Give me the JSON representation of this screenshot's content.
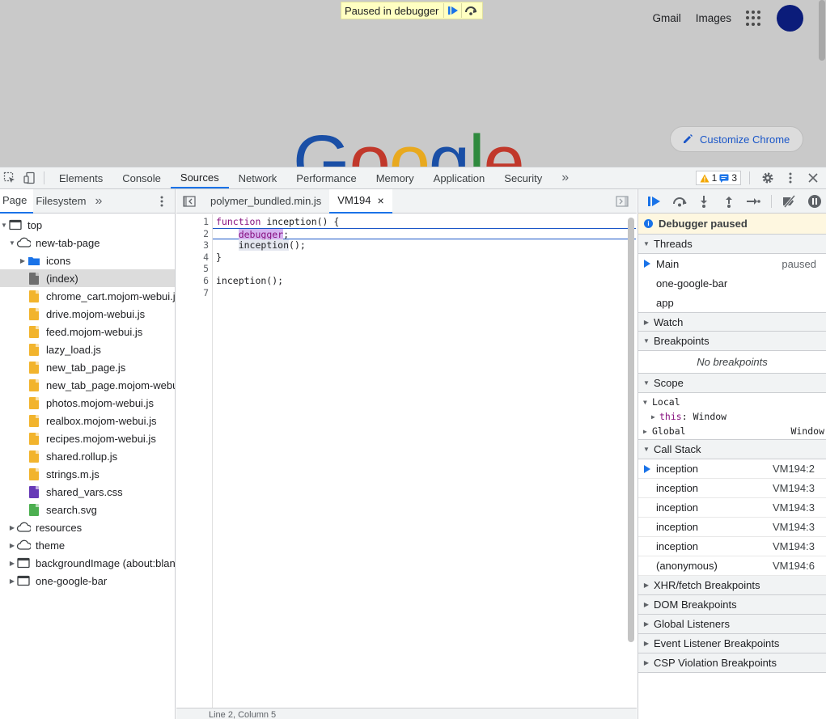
{
  "page": {
    "banner_text": "Paused in debugger",
    "links": [
      "Gmail",
      "Images"
    ],
    "logo": "Google",
    "customize_label": "Customize Chrome"
  },
  "toolbar": {
    "tabs": [
      "Elements",
      "Console",
      "Sources",
      "Network",
      "Performance",
      "Memory",
      "Application",
      "Security"
    ],
    "active_tab": "Sources",
    "more": "»",
    "warnings": "1",
    "messages": "3"
  },
  "navigator": {
    "tabs": [
      "Page",
      "Filesystem"
    ],
    "more": "»",
    "tree": [
      {
        "label": "top",
        "depth": 0,
        "type": "frame",
        "expanded": true
      },
      {
        "label": "new-tab-page",
        "depth": 1,
        "type": "cloud",
        "expanded": true
      },
      {
        "label": "icons",
        "depth": 2,
        "type": "folder",
        "expanded": false
      },
      {
        "label": "(index)",
        "depth": 2,
        "type": "file-grey",
        "selected": true
      },
      {
        "label": "chrome_cart.mojom-webui.js",
        "depth": 2,
        "type": "file-yellow"
      },
      {
        "label": "drive.mojom-webui.js",
        "depth": 2,
        "type": "file-yellow"
      },
      {
        "label": "feed.mojom-webui.js",
        "depth": 2,
        "type": "file-yellow"
      },
      {
        "label": "lazy_load.js",
        "depth": 2,
        "type": "file-yellow"
      },
      {
        "label": "new_tab_page.js",
        "depth": 2,
        "type": "file-yellow"
      },
      {
        "label": "new_tab_page.mojom-webui.js",
        "depth": 2,
        "type": "file-yellow"
      },
      {
        "label": "photos.mojom-webui.js",
        "depth": 2,
        "type": "file-yellow"
      },
      {
        "label": "realbox.mojom-webui.js",
        "depth": 2,
        "type": "file-yellow"
      },
      {
        "label": "recipes.mojom-webui.js",
        "depth": 2,
        "type": "file-yellow"
      },
      {
        "label": "shared.rollup.js",
        "depth": 2,
        "type": "file-yellow"
      },
      {
        "label": "strings.m.js",
        "depth": 2,
        "type": "file-yellow"
      },
      {
        "label": "shared_vars.css",
        "depth": 2,
        "type": "file-purple"
      },
      {
        "label": "search.svg",
        "depth": 2,
        "type": "file-green"
      },
      {
        "label": "resources",
        "depth": 1,
        "type": "cloud",
        "expanded": false
      },
      {
        "label": "theme",
        "depth": 1,
        "type": "cloud",
        "expanded": false
      },
      {
        "label": "backgroundImage (about:blank)",
        "depth": 1,
        "type": "frame",
        "expanded": false
      },
      {
        "label": "one-google-bar",
        "depth": 1,
        "type": "frame",
        "expanded": false
      }
    ]
  },
  "editor": {
    "tabs": [
      {
        "label": "polymer_bundled.min.js",
        "active": false
      },
      {
        "label": "VM194",
        "active": true,
        "close": "×"
      }
    ],
    "line_numbers": [
      "1",
      "2",
      "3",
      "4",
      "5",
      "6",
      "7"
    ],
    "lines": [
      {
        "parts": [
          {
            "t": "function",
            "c": "kw"
          },
          {
            "t": " inception() {",
            "c": ""
          }
        ]
      },
      {
        "parts": [
          {
            "t": "    ",
            "c": ""
          },
          {
            "t": "debugger",
            "c": "kw hl-purple"
          },
          {
            "t": ";",
            "c": ""
          }
        ],
        "exec": true
      },
      {
        "parts": [
          {
            "t": "    ",
            "c": ""
          },
          {
            "t": "inception",
            "c": "hl-grey"
          },
          {
            "t": "();",
            "c": ""
          }
        ]
      },
      {
        "parts": [
          {
            "t": "}",
            "c": ""
          }
        ]
      },
      {
        "parts": [
          {
            "t": "",
            "c": ""
          }
        ]
      },
      {
        "parts": [
          {
            "t": "inception();",
            "c": ""
          }
        ]
      },
      {
        "parts": [
          {
            "t": "",
            "c": ""
          }
        ]
      }
    ],
    "status": "Line 2, Column 5"
  },
  "sidebar": {
    "paused_msg": "Debugger paused",
    "threads_title": "Threads",
    "threads": [
      {
        "name": "Main",
        "state": "paused",
        "current": true
      },
      {
        "name": "one-google-bar",
        "state": ""
      },
      {
        "name": "app",
        "state": ""
      }
    ],
    "watch_title": "Watch",
    "breakpoints_title": "Breakpoints",
    "no_breakpoints": "No breakpoints",
    "scope_title": "Scope",
    "scope": {
      "local_label": "Local",
      "this_key": "this",
      "this_value": "Window",
      "global_label": "Global",
      "global_value": "Window"
    },
    "callstack_title": "Call Stack",
    "callstack": [
      {
        "fn": "inception",
        "loc": "VM194:2",
        "current": true
      },
      {
        "fn": "inception",
        "loc": "VM194:3"
      },
      {
        "fn": "inception",
        "loc": "VM194:3"
      },
      {
        "fn": "inception",
        "loc": "VM194:3"
      },
      {
        "fn": "inception",
        "loc": "VM194:3"
      },
      {
        "fn": "(anonymous)",
        "loc": "VM194:6"
      }
    ],
    "more_sections": [
      "XHR/fetch Breakpoints",
      "DOM Breakpoints",
      "Global Listeners",
      "Event Listener Breakpoints",
      "CSP Violation Breakpoints"
    ]
  },
  "colors": {
    "accent": "#1a73e8",
    "file_yellow": "#f2b42d",
    "file_purple": "#673ab7",
    "file_green": "#4caf50",
    "file_grey": "#6e6e6e",
    "folder_blue": "#1a73e8"
  }
}
